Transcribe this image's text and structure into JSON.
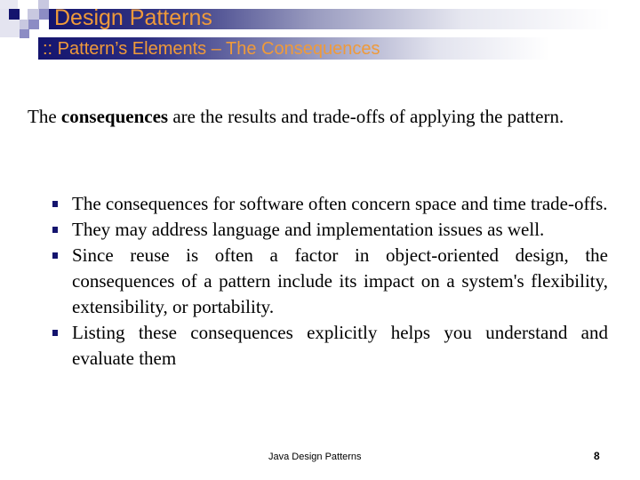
{
  "slide": {
    "title": "Design Patterns",
    "subtitle": ":: Pattern’s Elements – The Consequences",
    "intro": {
      "prefix": "The ",
      "emphasis": "consequences",
      "suffix": " are the results and trade-offs of applying the pattern."
    },
    "bullets": [
      {
        "text": "The consequences for software often concern space and time trade-offs."
      },
      {
        "text": "They may address language and implementation issues as well."
      },
      {
        "text": "Since reuse is often a factor in object-oriented design, the consequences of a pattern include its impact on a system's flexibility, extensibility, or portability."
      },
      {
        "text": "Listing these consequences explicitly helps you understand and evaluate them"
      }
    ],
    "footer": {
      "center": "Java Design Patterns",
      "page_number": "8"
    }
  },
  "colors": {
    "accent_navy": "#14146e",
    "title_orange": "#ef9a3a",
    "deco_light": "#c8c8e0",
    "deco_mid": "#8c8cc4",
    "deco_pale": "#e4e4f0"
  }
}
